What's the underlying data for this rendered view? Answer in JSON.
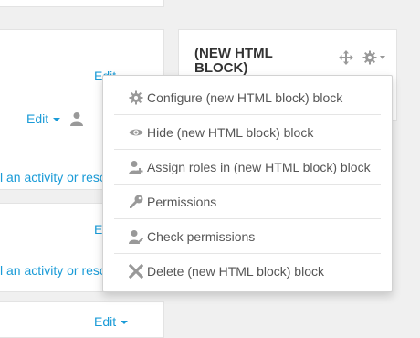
{
  "course": {
    "edit_label": "Edit",
    "add_activity_label": "l an activity or reso"
  },
  "block": {
    "title": "(NEW HTML BLOCK)"
  },
  "menu": {
    "items": [
      {
        "label": "Configure (new HTML block) block",
        "icon": "gear-icon"
      },
      {
        "label": "Hide (new HTML block) block",
        "icon": "eye-icon"
      },
      {
        "label": "Assign roles in (new HTML block) block",
        "icon": "assign-roles-icon"
      },
      {
        "label": "Permissions",
        "icon": "key-icon"
      },
      {
        "label": "Check permissions",
        "icon": "check-permissions-icon"
      },
      {
        "label": "Delete (new HTML block) block",
        "icon": "delete-icon"
      }
    ]
  },
  "colors": {
    "link": "#1a9bd7",
    "menu_text": "#555555",
    "icon": "#999999"
  }
}
